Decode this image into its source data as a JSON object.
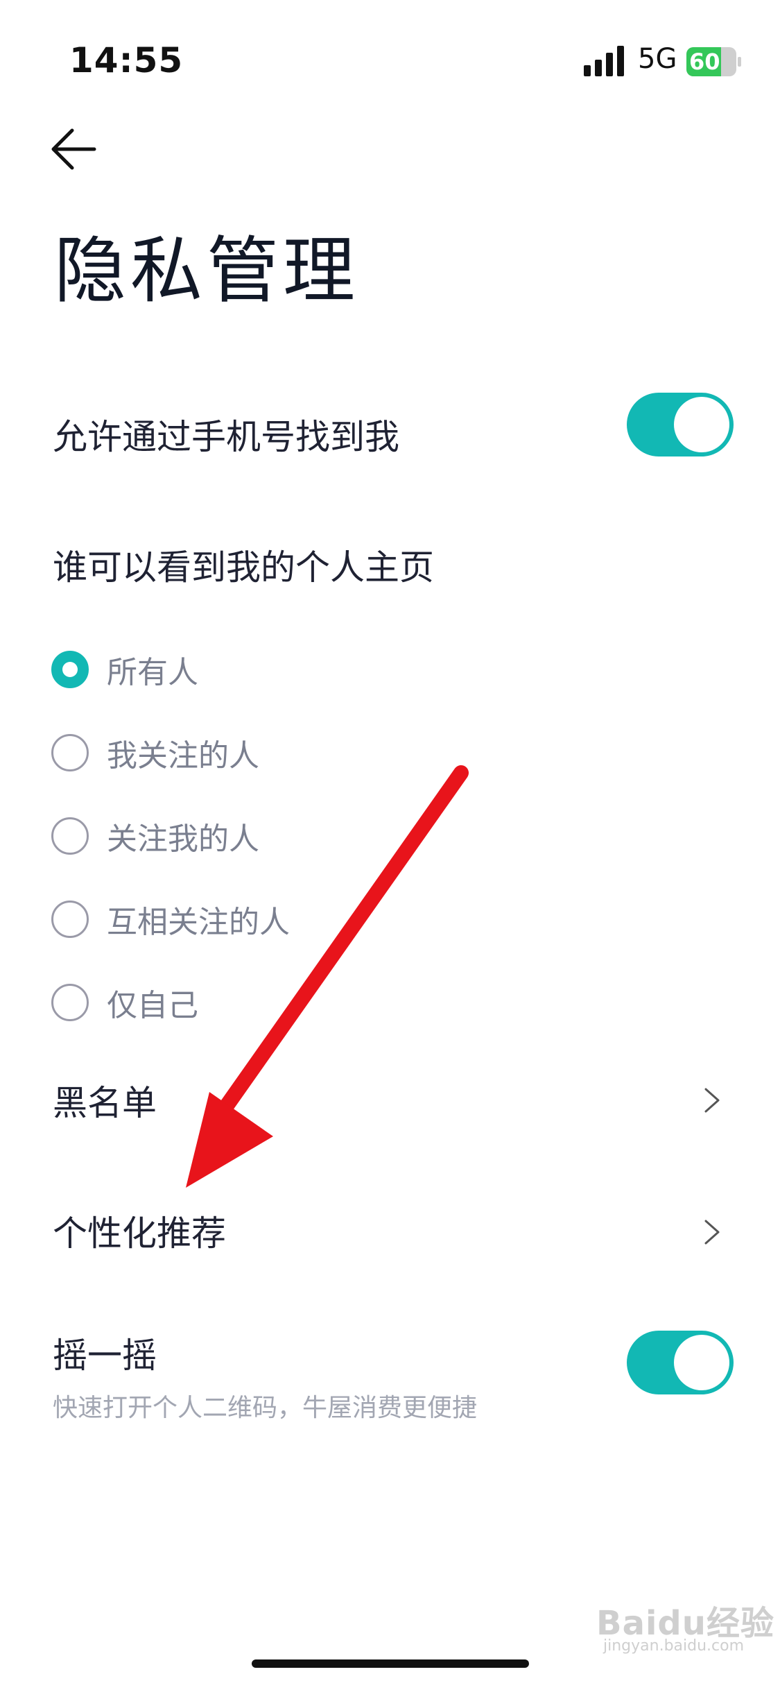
{
  "status_bar": {
    "time": "14:55",
    "network": "5G",
    "battery": "60"
  },
  "page": {
    "title": "隐私管理"
  },
  "settings": {
    "find_by_phone": {
      "label": "允许通过手机号找到我",
      "enabled": true
    },
    "profile_visibility": {
      "label": "谁可以看到我的个人主页",
      "options": [
        {
          "label": "所有人",
          "selected": true
        },
        {
          "label": "我关注的人",
          "selected": false
        },
        {
          "label": "关注我的人",
          "selected": false
        },
        {
          "label": "互相关注的人",
          "selected": false
        },
        {
          "label": "仅自己",
          "selected": false
        }
      ]
    },
    "blacklist": {
      "label": "黑名单"
    },
    "personalized": {
      "label": "个性化推荐"
    },
    "shake": {
      "label": "摇一摇",
      "desc": "快速打开个人二维码，牛屋消费更便捷",
      "enabled": true
    }
  },
  "watermark": {
    "brand": "Baidu经验",
    "site": "jingyan.baidu.com"
  },
  "colors": {
    "accent": "#12b8b4",
    "arrow": "#e8141b"
  }
}
